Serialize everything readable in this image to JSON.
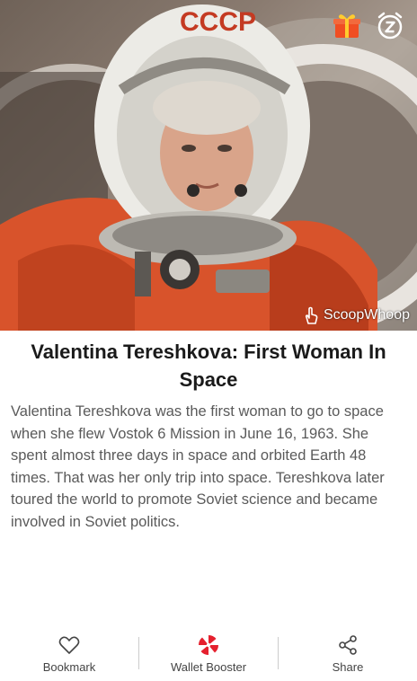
{
  "hero": {
    "helmet_text": "CCCP",
    "watermark": "ScoopWhoop"
  },
  "top_icons": {
    "gift": "gift-icon",
    "snooze": "snooze-alarm-icon"
  },
  "article": {
    "title": "Valentina Tereshkova: First Woman In Space",
    "body": "Valentina Tereshkova was the first woman to go to space when she flew Vostok 6 Mission in June 16, 1963. She spent almost three days in space and orbited Earth 48 times. That was her only trip into space. Tereshkova later toured the world to promote Soviet science and became involved in Soviet politics."
  },
  "bottom_bar": {
    "bookmark_label": "Bookmark",
    "wallet_label": "Wallet Booster",
    "share_label": "Share"
  },
  "colors": {
    "accent": "#e5202e",
    "gift": "#f04e23",
    "text": "#1a1a1a",
    "body_text": "#5a5a5a"
  }
}
